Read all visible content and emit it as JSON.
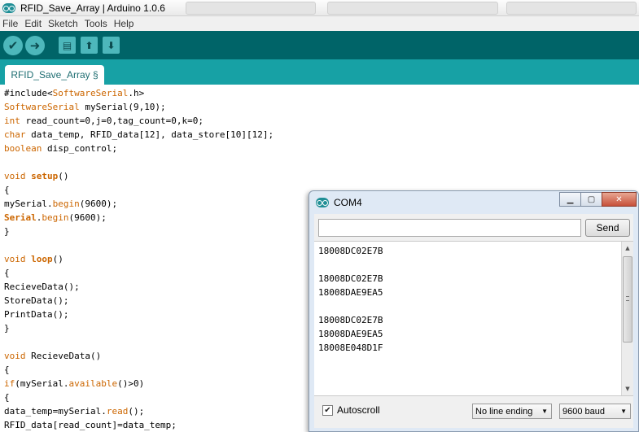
{
  "window": {
    "title": "RFID_Save_Array | Arduino 1.0.6"
  },
  "menu": [
    "File",
    "Edit",
    "Sketch",
    "Tools",
    "Help"
  ],
  "toolbar": {
    "verify_icon": "check-icon",
    "upload_icon": "right-arrow-icon",
    "new_icon": "document-icon",
    "open_icon": "up-arrow-icon",
    "save_icon": "down-arrow-icon"
  },
  "tab": {
    "label": "RFID_Save_Array §"
  },
  "code": [
    [
      {
        "t": "#include<"
      },
      {
        "t": "SoftwareSerial",
        "c": "kw"
      },
      {
        "t": ".h>"
      }
    ],
    [
      {
        "t": "SoftwareSerial",
        "c": "kw"
      },
      {
        "t": " mySerial(9,10);"
      }
    ],
    [
      {
        "t": "int",
        "c": "kw"
      },
      {
        "t": " read_count=0,j=0,tag_count=0,k=0;"
      }
    ],
    [
      {
        "t": "char",
        "c": "kw"
      },
      {
        "t": " data_temp, RFID_data[12], data_store[10][12];"
      }
    ],
    [
      {
        "t": "boolean",
        "c": "kw"
      },
      {
        "t": " disp_control;"
      }
    ],
    [],
    [
      {
        "t": "void",
        "c": "kw"
      },
      {
        "t": " "
      },
      {
        "t": "setup",
        "c": "kwb"
      },
      {
        "t": "()"
      }
    ],
    [
      {
        "t": "{"
      }
    ],
    [
      {
        "t": "mySerial."
      },
      {
        "t": "begin",
        "c": "kw"
      },
      {
        "t": "(9600);"
      }
    ],
    [
      {
        "t": "Serial",
        "c": "kwb"
      },
      {
        "t": "."
      },
      {
        "t": "begin",
        "c": "kw"
      },
      {
        "t": "(9600);"
      }
    ],
    [
      {
        "t": "}"
      }
    ],
    [],
    [
      {
        "t": "void",
        "c": "kw"
      },
      {
        "t": " "
      },
      {
        "t": "loop",
        "c": "kwb"
      },
      {
        "t": "()"
      }
    ],
    [
      {
        "t": "{"
      }
    ],
    [
      {
        "t": "RecieveData();"
      }
    ],
    [
      {
        "t": "StoreData();"
      }
    ],
    [
      {
        "t": "PrintData();"
      }
    ],
    [
      {
        "t": "}"
      }
    ],
    [],
    [
      {
        "t": "void",
        "c": "kw"
      },
      {
        "t": " RecieveData()"
      }
    ],
    [
      {
        "t": "{"
      }
    ],
    [
      {
        "t": "if",
        "c": "kw"
      },
      {
        "t": "(mySerial."
      },
      {
        "t": "available",
        "c": "kw"
      },
      {
        "t": "()>0)"
      }
    ],
    [
      {
        "t": "{"
      }
    ],
    [
      {
        "t": "data_temp=mySerial."
      },
      {
        "t": "read",
        "c": "kw"
      },
      {
        "t": "();"
      }
    ],
    [
      {
        "t": "RFID_data[read_count]=data_temp;"
      }
    ]
  ],
  "serial_monitor": {
    "title": "COM4",
    "input_value": "",
    "send_label": "Send",
    "output": [
      "18008DC02E7B",
      "",
      "18008DC02E7B",
      "18008DAE9EA5",
      "",
      "18008DC02E7B",
      "18008DAE9EA5",
      "18008E048D1F"
    ],
    "autoscroll_label": "Autoscroll",
    "autoscroll_checked": true,
    "line_ending": "No line ending",
    "baud": "9600 baud"
  }
}
